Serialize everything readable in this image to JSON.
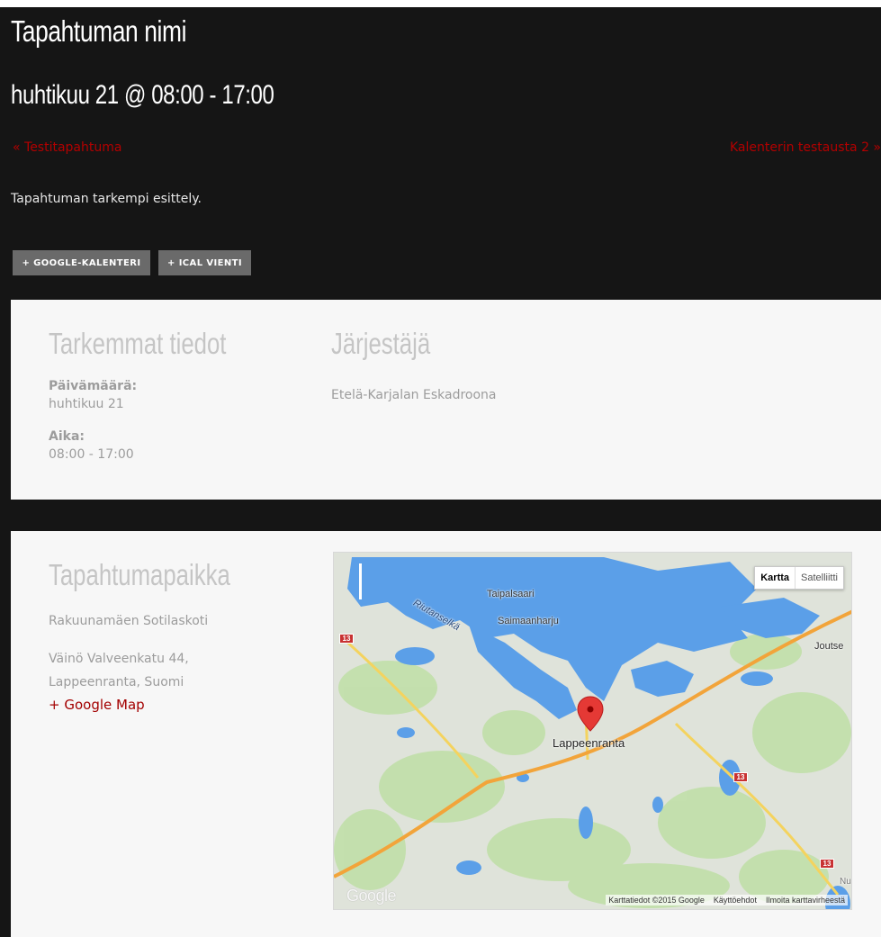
{
  "event": {
    "title": "Tapahtuman nimi",
    "datetime": "huhtikuu 21 @ 08:00 - 17:00",
    "prev_link": "« Testitapahtuma",
    "next_link": "Kalenterin testausta 2 »",
    "description": "Tapahtuman tarkempi esittely.",
    "buttons": {
      "google_calendar": "+ GOOGLE-KALENTERI",
      "ical_export": "+ ICAL VIENTI"
    }
  },
  "details": {
    "heading": "Tarkemmat tiedot",
    "date_label": "Päivämäärä:",
    "date_value": "huhtikuu 21",
    "time_label": "Aika:",
    "time_value": "08:00 - 17:00"
  },
  "organizer": {
    "heading": "Järjestäjä",
    "name": "Etelä-Karjalan Eskadroona"
  },
  "venue": {
    "heading": "Tapahtumapaikka",
    "name": "Rakuunamäen Sotilaskoti",
    "street": "Väinö Valveenkatu 44,",
    "city": "Lappeenranta, Suomi",
    "map_link": "+ Google Map"
  },
  "map": {
    "type_map": "Kartta",
    "type_satellite": "Satelliitti",
    "labels": {
      "lappeenranta": "Lappeenranta",
      "taipalsaari": "Taipalsaari",
      "saimaanharju": "Saimaanharju",
      "riutanselka": "Riutanselkä",
      "joutse": "Joutse",
      "nu": "Nu"
    },
    "road_number": "13",
    "logo": "Google",
    "footer": {
      "data": "Karttatiedot ©2015 Google",
      "terms": "Käyttöehdot",
      "report": "Ilmoita karttavirheestä"
    },
    "colors": {
      "water": "#5b9fe8",
      "land": "#dfe3da",
      "forest": "#c1dfa9",
      "main_road": "#f2a43a",
      "secondary_road": "#f4d35e",
      "marker": "#e53935"
    }
  },
  "colors": {
    "page_background": "#151515",
    "panel_background": "#f7f7f7",
    "link_red": "#b30000",
    "button_gray": "#6a6a6a"
  }
}
